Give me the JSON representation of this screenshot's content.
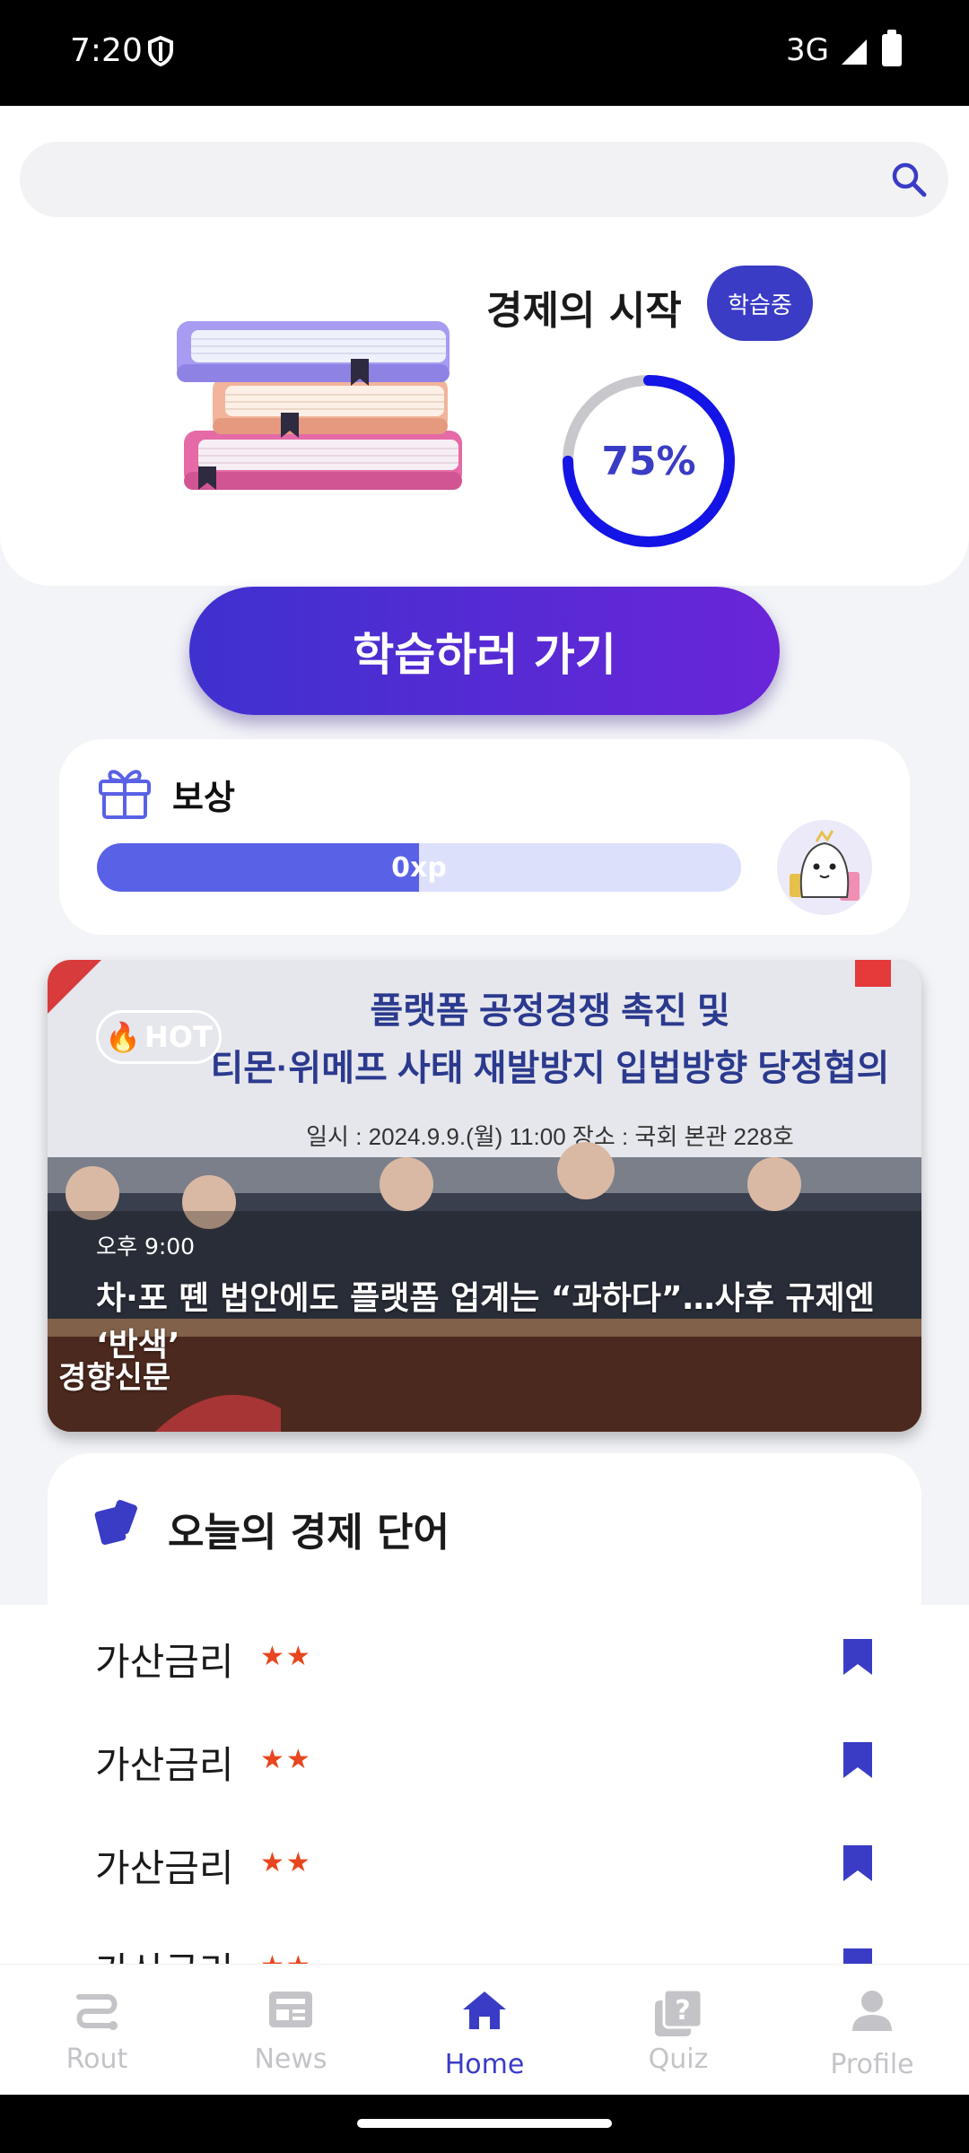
{
  "status_bar": {
    "time": "7:20",
    "network": "3G"
  },
  "search": {
    "placeholder": ""
  },
  "course": {
    "title": "경제의 시작",
    "badge": "학습중",
    "progress": 0.75,
    "progress_label": "75%"
  },
  "study_button": {
    "label": "학습하러 가기"
  },
  "reward": {
    "title": "보상",
    "xp_label": "0xp",
    "xp_fill": 0.5
  },
  "news": {
    "hot_label": "HOT",
    "time": "오후 9:00",
    "headline": "차·포 뗀 법안에도 플랫폼 업계는 “과하다”…사후 규제엔 ‘반색’",
    "source": "경향신문",
    "banner_line1": "플랫폼 공정경쟁 촉진 및",
    "banner_line2": "티몬·위메프 사태 재발방지 입법방향 당정협의",
    "banner_line3": "일시 : 2024.9.9.(월) 11:00    장소 : 국회 본관 228호"
  },
  "vocab": {
    "title": "오늘의 경제 단어",
    "items": [
      {
        "word": "가산금리",
        "stars": "★★"
      },
      {
        "word": "가산금리",
        "stars": "★★"
      },
      {
        "word": "가산금리",
        "stars": "★★"
      },
      {
        "word": "가산금리",
        "stars": "★★"
      }
    ]
  },
  "nav": {
    "items": [
      {
        "label": "Rout",
        "icon": "route-icon"
      },
      {
        "label": "News",
        "icon": "news-icon"
      },
      {
        "label": "Home",
        "icon": "home-icon"
      },
      {
        "label": "Quiz",
        "icon": "quiz-icon"
      },
      {
        "label": "Profile",
        "icon": "profile-icon"
      }
    ],
    "active": "Home"
  },
  "colors": {
    "accent": "#3a3cc6",
    "star": "#e8461e",
    "gradient_start": "#3f31cf",
    "gradient_end": "#6a25d8"
  }
}
